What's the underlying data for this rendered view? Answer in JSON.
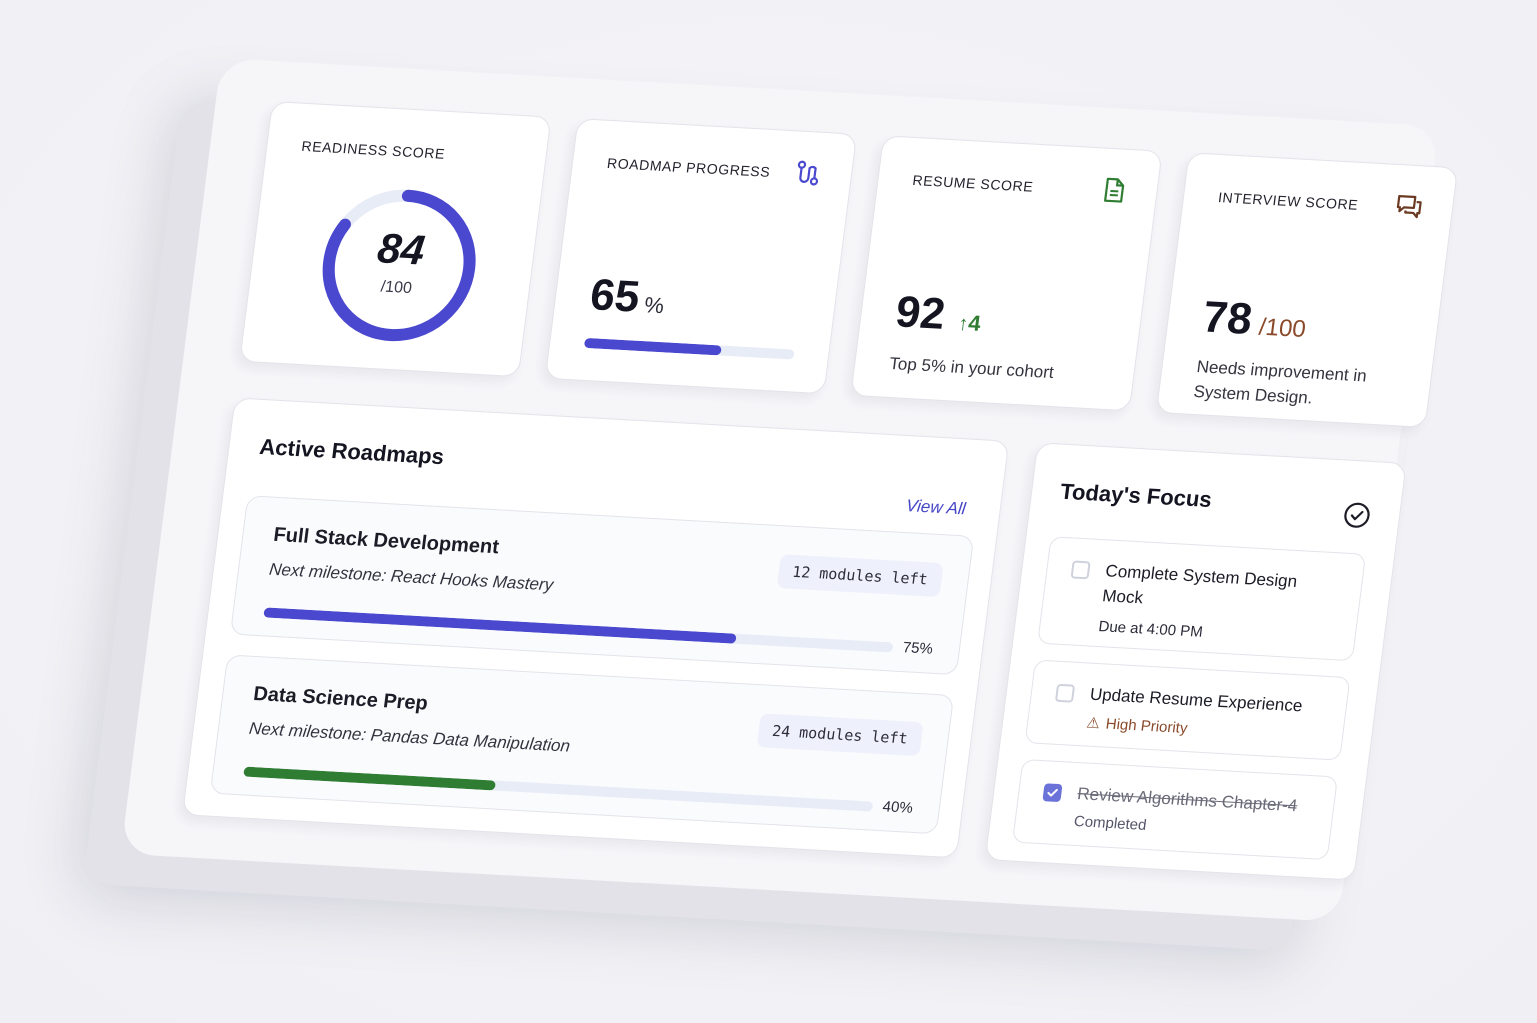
{
  "stats": {
    "readiness": {
      "title": "READINESS SCORE",
      "value": "84",
      "max_label": "/100",
      "fraction": 0.84
    },
    "roadmap": {
      "title": "ROADMAP PROGRESS",
      "value": "65",
      "unit": "%",
      "fraction": 0.65,
      "icon": "route-icon"
    },
    "resume": {
      "title": "RESUME SCORE",
      "value": "92",
      "delta": "4",
      "note": "Top 5% in your cohort",
      "icon": "document-icon"
    },
    "interview": {
      "title": "INTERVIEW SCORE",
      "value": "78",
      "max_label": "/100",
      "note": "Needs improvement in System Design.",
      "icon": "chat-bubbles-icon"
    }
  },
  "roadmaps": {
    "title": "Active Roadmaps",
    "view_all": "View All",
    "items": [
      {
        "name": "Full Stack Development",
        "milestone": "Next milestone: React Hooks Mastery",
        "modules": "12 modules left",
        "percent_label": "75%",
        "fraction": 0.75,
        "color": "#4a48cf"
      },
      {
        "name": "Data Science Prep",
        "milestone": "Next milestone: Pandas Data Manipulation",
        "modules": "24 modules left",
        "percent_label": "40%",
        "fraction": 0.4,
        "color": "#2f7d32"
      }
    ]
  },
  "focus": {
    "title": "Today's Focus",
    "icon": "check-circle-icon",
    "tasks": [
      {
        "title": "Complete System Design Mock",
        "meta": "Due at 4:00 PM",
        "checked": false
      },
      {
        "title": "Update Resume Experience",
        "meta": "High Priority",
        "checked": false
      },
      {
        "title": "Review Algorithms Chapter-4",
        "meta": "Completed",
        "checked": true
      }
    ]
  },
  "colors": {
    "accent": "#4a48cf",
    "success": "#2f7d32",
    "warning": "#8a4a2a",
    "track": "#e8ecf7"
  }
}
